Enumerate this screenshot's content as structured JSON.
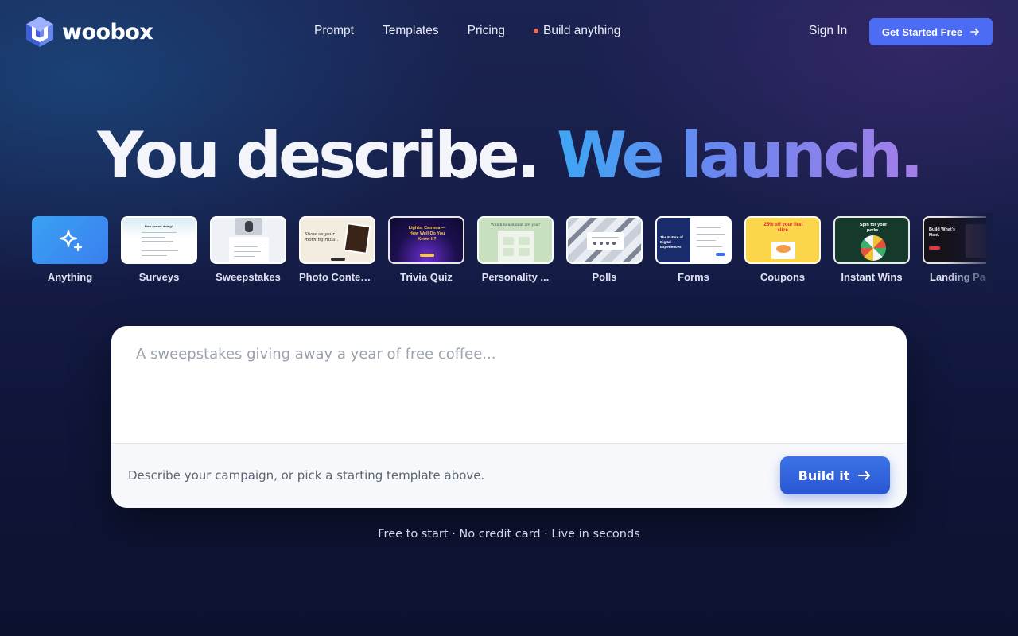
{
  "brand": {
    "name": "woobox"
  },
  "nav": {
    "links": [
      "Prompt",
      "Templates",
      "Pricing",
      "Build anything"
    ],
    "sign_in": "Sign In",
    "cta": "Get Started Free"
  },
  "hero": {
    "part1": "You describe.",
    "part2": "We launch."
  },
  "templates": [
    {
      "label": "Anything",
      "icon": "sparkle-icon"
    },
    {
      "label": "Surveys",
      "preview_text": "How are we doing?"
    },
    {
      "label": "Sweepstakes"
    },
    {
      "label": "Photo Contests",
      "preview_text": "Show us your morning ritual."
    },
    {
      "label": "Trivia Quiz",
      "preview_text": "Lights, Camera — How Well Do You Know It?"
    },
    {
      "label": "Personality ...",
      "preview_text": "Which houseplant are you?"
    },
    {
      "label": "Polls"
    },
    {
      "label": "Forms",
      "preview_text": "The Future of Digital Experiences"
    },
    {
      "label": "Coupons",
      "preview_text": "25% off your first slice."
    },
    {
      "label": "Instant Wins",
      "preview_text": "Spin for your perks."
    },
    {
      "label": "Landing Pag",
      "preview_text": "Build What's Next."
    }
  ],
  "composer": {
    "placeholder": "A sweepstakes giving away a year of free coffee...",
    "hint": "Describe your campaign, or pick a starting template above.",
    "button": "Build it"
  },
  "footnote": "Free to start · No credit card · Live in seconds",
  "colors": {
    "accent": "#4b6cf3",
    "build_button": "#2b56d4",
    "nav_dot": "#f06a4d",
    "hero_gradient": [
      "#3ea6f5",
      "#a67ee9"
    ]
  }
}
